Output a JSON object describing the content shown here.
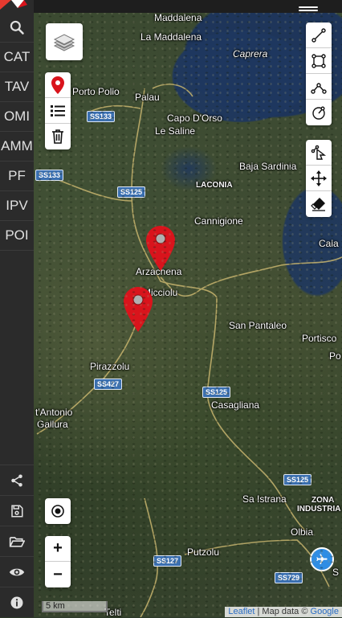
{
  "sidebar": {
    "top_items": [
      {
        "name": "search-icon",
        "label": ""
      },
      {
        "name": "nav-cat",
        "label": "CAT"
      },
      {
        "name": "nav-tav",
        "label": "TAV"
      },
      {
        "name": "nav-omi",
        "label": "OMI"
      },
      {
        "name": "nav-amm",
        "label": "AMM"
      },
      {
        "name": "nav-pf",
        "label": "PF"
      },
      {
        "name": "nav-ipv",
        "label": "IPV"
      },
      {
        "name": "nav-poi",
        "label": "POI"
      }
    ],
    "bottom_icons": [
      "share-icon",
      "save-icon",
      "folder-open-icon",
      "eye-icon",
      "info-icon"
    ]
  },
  "topbar": {
    "menu_icon": "hamburger-menu-icon"
  },
  "map": {
    "places": {
      "maddalena": "Maddalena",
      "la_maddalena": "La Maddalena",
      "caprera": "Caprera",
      "porto_pollo": "Porto Pollo",
      "palau": "Palau",
      "capo_dorso": "Capo D'Orso",
      "le_saline": "Le Saline",
      "baja_sardinia": "Baja Sardinia",
      "laconia": "LACONIA",
      "cannigione": "Cannigione",
      "cala": "Cala",
      "arzachena": "Arzachena",
      "micciolu": "Micciolu",
      "san_pantaleo": "San Pantaleo",
      "portisco": "Portisco",
      "po": "Po",
      "pirazzolu": "Pirazzolu",
      "casagliana": "Casagliana",
      "santantonio": "t'Antonio",
      "gallura": "Gallura",
      "sa_istrana": "Sa Istrana",
      "zona": "ZONA",
      "industriale": "INDUSTRIA",
      "olbia": "Olbia",
      "putzolu": "Putzolu",
      "s": "S",
      "telti": "Telti"
    },
    "roads": {
      "ss133_a": "SS133",
      "ss133_b": "SS133",
      "ss125_a": "SS125",
      "ss125_b": "SS125",
      "ss125_c": "SS125",
      "ss427": "SS427",
      "ss127": "SS127",
      "ss729": "SS729"
    },
    "scale": "5 km",
    "attribution": {
      "leaflet": "Leaflet",
      "sep": " | Map data © ",
      "google": "Google"
    }
  },
  "controls": {
    "layers_icon": "layers-icon",
    "draw_tools": [
      "marker-icon",
      "list-icon",
      "trash-icon"
    ],
    "right_tools_1": [
      "polyline-icon",
      "polygon-icon",
      "path-icon",
      "circle-icon"
    ],
    "right_tools_2": [
      "edit-pointer-icon",
      "move-icon",
      "eraser-icon"
    ],
    "locate_icon": "locate-icon",
    "zoom_in": "+",
    "zoom_out": "−"
  },
  "colors": {
    "marker": "#d9141c",
    "sidebar_bg": "#2b2b2b",
    "road_label": "#3a6fb0"
  }
}
